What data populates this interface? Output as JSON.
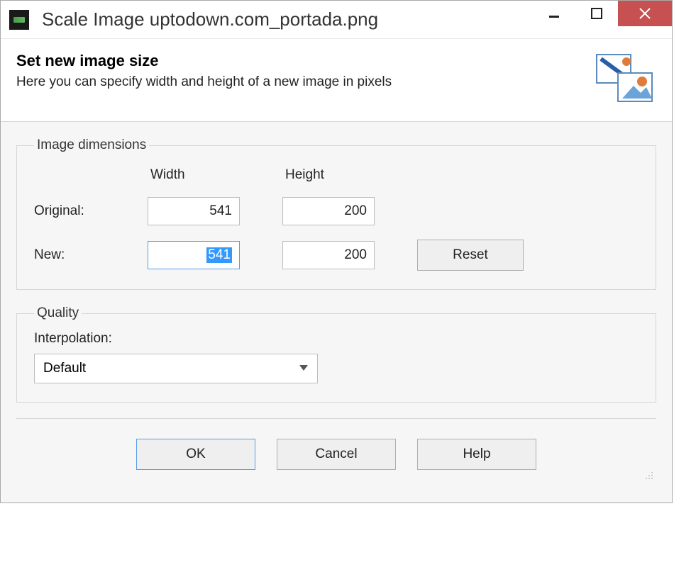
{
  "window": {
    "title": "Scale Image uptodown.com_portada.png"
  },
  "header": {
    "title": "Set new image size",
    "subtitle": "Here you can specify width and height of a new image in pixels"
  },
  "dimensions": {
    "legend": "Image dimensions",
    "width_label": "Width",
    "height_label": "Height",
    "original_label": "Original:",
    "new_label": "New:",
    "original_width": "541",
    "original_height": "200",
    "new_width": "541",
    "new_height": "200",
    "reset_label": "Reset"
  },
  "quality": {
    "legend": "Quality",
    "interpolation_label": "Interpolation:",
    "selected": "Default"
  },
  "footer": {
    "ok": "OK",
    "cancel": "Cancel",
    "help": "Help"
  }
}
